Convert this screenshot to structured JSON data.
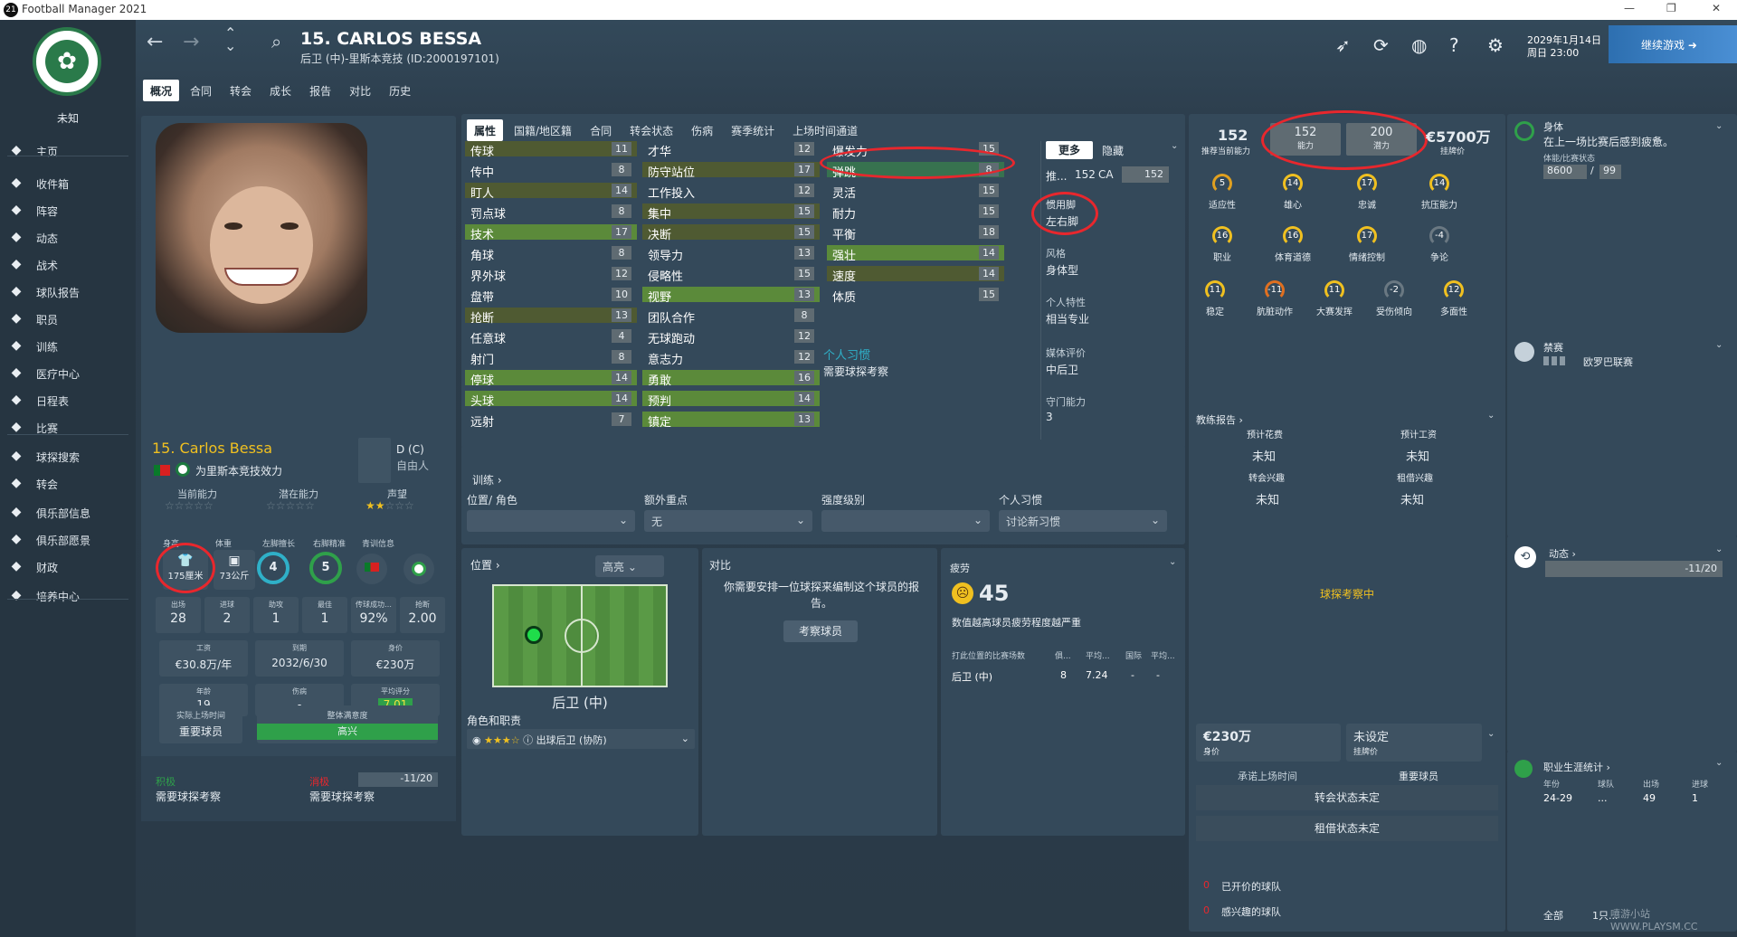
{
  "window": {
    "app_icon": "21",
    "title": "Football Manager 2021"
  },
  "sidebar": {
    "club_name": "未知",
    "items": [
      {
        "icon": "home-icon",
        "label": "主页"
      },
      {
        "icon": "inbox-icon",
        "label": "收件箱"
      },
      {
        "icon": "squad-icon",
        "label": "阵容"
      },
      {
        "icon": "dynamics-icon",
        "label": "动态"
      },
      {
        "icon": "tactics-icon",
        "label": "战术"
      },
      {
        "icon": "report-icon",
        "label": "球队报告"
      },
      {
        "icon": "staff-icon",
        "label": "职员"
      },
      {
        "icon": "training-icon",
        "label": "训练"
      },
      {
        "icon": "medical-icon",
        "label": "医疗中心"
      },
      {
        "icon": "calendar-icon",
        "label": "日程表"
      },
      {
        "icon": "trophy-icon",
        "label": "比赛"
      },
      {
        "icon": "search-icon",
        "label": "球探搜索"
      },
      {
        "icon": "transfer-icon",
        "label": "转会"
      },
      {
        "icon": "club-info-icon",
        "label": "俱乐部信息"
      },
      {
        "icon": "vision-icon",
        "label": "俱乐部愿景"
      },
      {
        "icon": "finance-icon",
        "label": "财政"
      },
      {
        "icon": "development-icon",
        "label": "培养中心"
      }
    ]
  },
  "header": {
    "player_title": "15. CARLOS BESSA",
    "player_subtitle": "后卫 (中)-里斯本竞技 (ID:2000197101)",
    "tabs": [
      "概况",
      "合同",
      "转会",
      "成长",
      "报告",
      "对比",
      "历史"
    ],
    "date_line1": "2029年1月14日",
    "date_line2": "周日 23:00",
    "continue_label": "继续游戏"
  },
  "profile": {
    "name": "15. Carlos Bessa",
    "club_line": "为里斯本竞技效力",
    "position": "D (C)",
    "position_sub": "自由人",
    "labels": {
      "ca": "当前能力",
      "pa": "潜在能力",
      "rep": "声望"
    },
    "stats_labels": [
      "身高",
      "体重",
      "左脚擅长",
      "右脚精准",
      "青训信息"
    ],
    "height": "175厘米",
    "weight": "73公斤",
    "left_foot": "4",
    "right_foot": "5",
    "career": [
      {
        "l": "出场",
        "v": "28"
      },
      {
        "l": "进球",
        "v": "2"
      },
      {
        "l": "助攻",
        "v": "1"
      },
      {
        "l": "最佳",
        "v": "1"
      },
      {
        "l": "传球成功…",
        "v": "92%"
      },
      {
        "l": "抢断",
        "v": "2.00"
      }
    ],
    "money": [
      {
        "l": "工资",
        "v": "€30.8万/年"
      },
      {
        "l": "到期",
        "v": "2032/6/30"
      },
      {
        "l": "身价",
        "v": "€230万"
      }
    ],
    "misc": [
      {
        "l": "年龄",
        "v": "19"
      },
      {
        "l": "伤病",
        "v": "-"
      },
      {
        "l": "平均评分",
        "v": "7.01"
      }
    ],
    "playtime_label": "实际上场时间",
    "playtime_value": "重要球员",
    "satisfaction_label": "整体满意度",
    "satisfaction_value": "高兴",
    "positive_label": "积极",
    "positive_value": "需要球探考察",
    "negative_label": "消极",
    "negative_value": "需要球探考察",
    "morale_bar": "-11/20"
  },
  "attributes": {
    "tabs": [
      "属性",
      "国籍/地区籍",
      "合同",
      "转会状态",
      "伤病",
      "赛季统计",
      "上场时间通道"
    ],
    "col1": [
      {
        "n": "传球",
        "v": "11",
        "c": "y"
      },
      {
        "n": "传中",
        "v": "8",
        "c": ""
      },
      {
        "n": "盯人",
        "v": "14",
        "c": "y"
      },
      {
        "n": "罚点球",
        "v": "8",
        "c": ""
      },
      {
        "n": "技术",
        "v": "17",
        "c": "g"
      },
      {
        "n": "角球",
        "v": "8",
        "c": ""
      },
      {
        "n": "界外球",
        "v": "12",
        "c": ""
      },
      {
        "n": "盘带",
        "v": "10",
        "c": ""
      },
      {
        "n": "抢断",
        "v": "13",
        "c": "y"
      },
      {
        "n": "任意球",
        "v": "4",
        "c": ""
      },
      {
        "n": "射门",
        "v": "8",
        "c": ""
      },
      {
        "n": "停球",
        "v": "14",
        "c": "g"
      },
      {
        "n": "头球",
        "v": "14",
        "c": "g"
      },
      {
        "n": "远射",
        "v": "7",
        "c": ""
      }
    ],
    "col2": [
      {
        "n": "才华",
        "v": "12",
        "c": ""
      },
      {
        "n": "防守站位",
        "v": "17",
        "c": "y"
      },
      {
        "n": "工作投入",
        "v": "12",
        "c": ""
      },
      {
        "n": "集中",
        "v": "15",
        "c": "y"
      },
      {
        "n": "决断",
        "v": "15",
        "c": "y"
      },
      {
        "n": "领导力",
        "v": "13",
        "c": ""
      },
      {
        "n": "侵略性",
        "v": "15",
        "c": ""
      },
      {
        "n": "视野",
        "v": "13",
        "c": "g"
      },
      {
        "n": "团队合作",
        "v": "8",
        "c": ""
      },
      {
        "n": "无球跑动",
        "v": "12",
        "c": ""
      },
      {
        "n": "意志力",
        "v": "12",
        "c": ""
      },
      {
        "n": "勇敢",
        "v": "16",
        "c": "g"
      },
      {
        "n": "预判",
        "v": "14",
        "c": "g"
      },
      {
        "n": "镇定",
        "v": "13",
        "c": "g"
      }
    ],
    "col3": [
      {
        "n": "爆发力",
        "v": "15",
        "c": ""
      },
      {
        "n": "弹跳",
        "v": "8",
        "c": "gc"
      },
      {
        "n": "灵活",
        "v": "15",
        "c": ""
      },
      {
        "n": "耐力",
        "v": "15",
        "c": ""
      },
      {
        "n": "平衡",
        "v": "18",
        "c": ""
      },
      {
        "n": "强壮",
        "v": "14",
        "c": "g"
      },
      {
        "n": "速度",
        "v": "14",
        "c": "y"
      },
      {
        "n": "体质",
        "v": "15",
        "c": ""
      }
    ],
    "traits_link": "个人习惯",
    "traits_value": "需要球探考察",
    "more_btn": "更多",
    "hide_btn": "隐藏",
    "ca_line_prefix": "推...",
    "ca_value": "152",
    "ca_label": "CA",
    "ca_box": "152",
    "foot_label": "惯用脚",
    "foot_value": "左右脚",
    "style_label": "风格",
    "style_value": "身体型",
    "pers_label": "个人特性",
    "pers_value": "相当专业",
    "media_label": "媒体评价",
    "media_value": "中后卫",
    "gk_label": "守门能力",
    "gk_value": "3"
  },
  "training": {
    "title": "训练",
    "labels": [
      "位置/ 角色",
      "额外重点",
      "强度级别",
      "个人习惯"
    ],
    "values": [
      "",
      "无",
      "",
      "讨论新习惯"
    ]
  },
  "position_panel": {
    "title": "位置",
    "dropdown": "高亮",
    "pos_label": "后卫 (中)",
    "role_title": "角色和职责",
    "role_value": "出球后卫 (协防)"
  },
  "compare": {
    "title": "对比",
    "text": "你需要安排一位球探来编制这个球员的报告。",
    "button": "考察球员"
  },
  "fatigue": {
    "title": "疲劳",
    "value": "45",
    "desc": "数值越高球员疲劳程度越严重",
    "headers": [
      "打此位置的比赛场数",
      "俱...",
      "平均...",
      "国际",
      "平均..."
    ],
    "row": [
      "后卫 (中)",
      "8",
      "7.24",
      "-",
      "-"
    ]
  },
  "ability": {
    "rec_ca": "152",
    "rec_ca_label": "推荐当前能力",
    "ca": "152",
    "ca_label": "能力",
    "pa": "200",
    "pa_label": "潜力",
    "price": "€5700万",
    "price_label": "挂牌价",
    "gauges": [
      {
        "v": "5",
        "l": "适应性"
      },
      {
        "v": "14",
        "l": "雄心"
      },
      {
        "v": "17",
        "l": "忠诚"
      },
      {
        "v": "14",
        "l": "抗压能力"
      },
      {
        "v": "16",
        "l": "职业"
      },
      {
        "v": "16",
        "l": "体育道德"
      },
      {
        "v": "17",
        "l": "情绪控制"
      },
      {
        "v": "-4",
        "l": "争论"
      },
      {
        "v": "11",
        "l": "稳定"
      },
      {
        "v": "-11",
        "l": "肮脏动作"
      },
      {
        "v": "11",
        "l": "大赛发挥"
      },
      {
        "v": "-2",
        "l": "受伤倾向"
      },
      {
        "v": "12",
        "l": "多面性"
      }
    ]
  },
  "coach_report": {
    "title": "教练报告",
    "fee_label": "预计花费",
    "fee_value": "未知",
    "wage_label": "预计工资",
    "wage_value": "未知",
    "transfer_label": "转会兴趣",
    "transfer_value": "未知",
    "loan_label": "租借兴趣",
    "loan_value": "未知",
    "center_text": "球探考察中"
  },
  "value_panel": {
    "value": "€230万",
    "value_label": "身价",
    "asking": "未设定",
    "asking_label": "挂牌价",
    "promised_label": "承诺上场时间",
    "promised_value": "重要球员",
    "transfer_status": "转会状态未定",
    "loan_status": "租借状态未定",
    "offers_count": "0",
    "offers_label": "已开价的球队",
    "interested_count": "0",
    "interested_label": "感兴趣的球队"
  },
  "right": {
    "body_title": "身体",
    "body_text": "在上一场比赛后感到疲惫。",
    "body_sub": "体能/比赛状态",
    "fitness": "8600",
    "fitness_sep": "/",
    "match_sharpness": "99",
    "ban_title": "禁赛",
    "ban_value": "欧罗巴联赛",
    "dyn_title": "动态",
    "dyn_value": "-11/20",
    "career_title": "职业生涯统计",
    "career_headers": [
      "年份",
      "球队",
      "出场",
      "进球"
    ],
    "career_row": [
      "24-29",
      "...",
      "49",
      "1"
    ],
    "footer_all": "全部",
    "footer_1": "1只..."
  },
  "watermark": "嘻游小站 WWW.PLAYSM.CC",
  "colors": {
    "accent": "#2d6fb0",
    "green": "#2fa04a",
    "red_mark": "#e8272d",
    "gauge": "#f0c020"
  }
}
